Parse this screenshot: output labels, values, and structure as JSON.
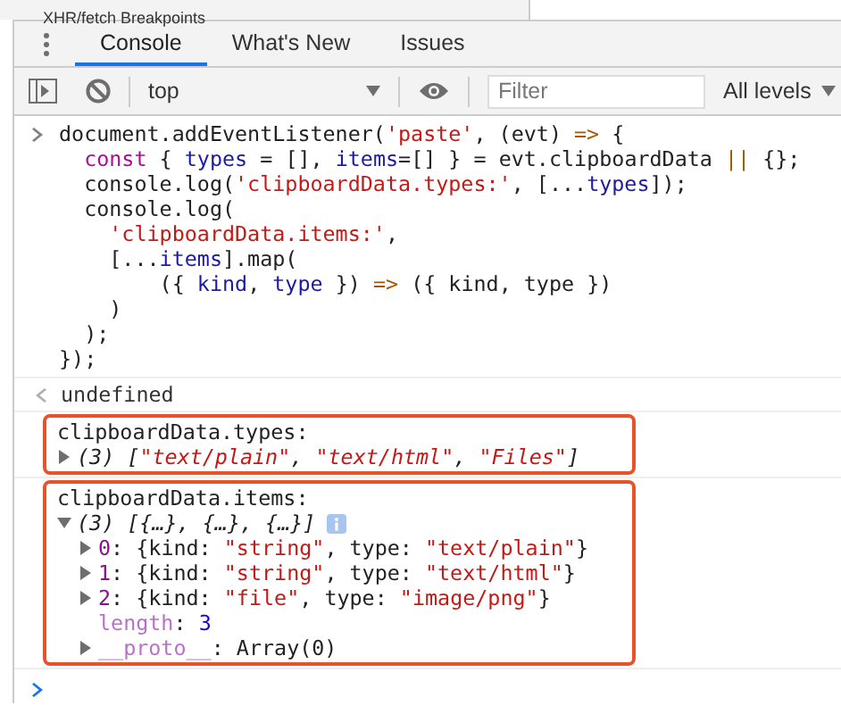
{
  "background_panel": {
    "text": "XHR/fetch Breakpoints"
  },
  "tabs": [
    {
      "label": "Console",
      "selected": true
    },
    {
      "label": "What's New",
      "selected": false
    },
    {
      "label": "Issues",
      "selected": false
    }
  ],
  "toolbar": {
    "context": "top",
    "filter": {
      "placeholder": "Filter"
    },
    "levels": "All levels"
  },
  "messages": [
    {
      "kind": "input",
      "lines": [
        [
          {
            "text": "document.addEventListener(",
            "kind": "plain"
          },
          {
            "text": "'paste'",
            "kind": "string"
          },
          {
            "text": ", (evt) ",
            "kind": "plain"
          },
          {
            "text": "=>",
            "kind": "operator"
          },
          {
            "text": " {",
            "kind": "plain"
          }
        ],
        [
          {
            "text": "  const",
            "kind": "keyword"
          },
          {
            "text": " { ",
            "kind": "plain"
          },
          {
            "text": "types",
            "kind": "name"
          },
          {
            "text": " = [], ",
            "kind": "plain"
          },
          {
            "text": "items",
            "kind": "name"
          },
          {
            "text": "=[] } = evt.clipboardData ",
            "kind": "plain"
          },
          {
            "text": "||",
            "kind": "operator"
          },
          {
            "text": " {};",
            "kind": "plain"
          }
        ],
        [
          {
            "text": "  console.log(",
            "kind": "plain"
          },
          {
            "text": "'clipboardData.types:'",
            "kind": "string"
          },
          {
            "text": ", [...",
            "kind": "plain"
          },
          {
            "text": "types",
            "kind": "name"
          },
          {
            "text": "]);",
            "kind": "plain"
          }
        ],
        [
          {
            "text": "  console.log(",
            "kind": "plain"
          }
        ],
        [
          {
            "text": "    'clipboardData.items:'",
            "kind": "string"
          },
          {
            "text": ",",
            "kind": "plain"
          }
        ],
        [
          {
            "text": "    [...",
            "kind": "plain"
          },
          {
            "text": "items",
            "kind": "name"
          },
          {
            "text": "].map(",
            "kind": "plain"
          }
        ],
        [
          {
            "text": "        ({ ",
            "kind": "plain"
          },
          {
            "text": "kind",
            "kind": "name"
          },
          {
            "text": ", ",
            "kind": "plain"
          },
          {
            "text": "type",
            "kind": "name"
          },
          {
            "text": " }) ",
            "kind": "plain"
          },
          {
            "text": "=>",
            "kind": "operator"
          },
          {
            "text": " ({ kind, type })",
            "kind": "plain"
          }
        ],
        [
          {
            "text": "    )",
            "kind": "plain"
          }
        ],
        [
          {
            "text": "  );",
            "kind": "plain"
          }
        ],
        [
          {
            "text": "});",
            "kind": "plain"
          }
        ]
      ]
    },
    {
      "kind": "result",
      "text": "undefined"
    },
    {
      "kind": "log",
      "highlighted": true,
      "label": "clipboardData.types:",
      "tree": {
        "kind": "object",
        "expanded": false,
        "tokens": [
          {
            "text": "(3) [",
            "kind": "plain"
          },
          {
            "text": "\"text/plain\"",
            "kind": "string"
          },
          {
            "text": ", ",
            "kind": "plain"
          },
          {
            "text": "\"text/html\"",
            "kind": "string"
          },
          {
            "text": ", ",
            "kind": "plain"
          },
          {
            "text": "\"Files\"",
            "kind": "string"
          },
          {
            "text": "]",
            "kind": "plain"
          }
        ]
      }
    },
    {
      "kind": "log",
      "highlighted": true,
      "label": "clipboardData.items:",
      "tree": {
        "kind": "object",
        "expanded": true,
        "info": true,
        "tokens": [
          {
            "text": "(3) [{…}, {…}, {…}]",
            "kind": "plain"
          }
        ],
        "children": [
          {
            "kind": "object",
            "expanded": false,
            "tokens": [
              {
                "text": "0",
                "kind": "index"
              },
              {
                "text": ": {kind: ",
                "kind": "plain"
              },
              {
                "text": "\"string\"",
                "kind": "string"
              },
              {
                "text": ", type: ",
                "kind": "plain"
              },
              {
                "text": "\"text/plain\"",
                "kind": "string"
              },
              {
                "text": "}",
                "kind": "plain"
              }
            ]
          },
          {
            "kind": "object",
            "expanded": false,
            "tokens": [
              {
                "text": "1",
                "kind": "index"
              },
              {
                "text": ": {kind: ",
                "kind": "plain"
              },
              {
                "text": "\"string\"",
                "kind": "string"
              },
              {
                "text": ", type: ",
                "kind": "plain"
              },
              {
                "text": "\"text/html\"",
                "kind": "string"
              },
              {
                "text": "}",
                "kind": "plain"
              }
            ]
          },
          {
            "kind": "object",
            "expanded": false,
            "tokens": [
              {
                "text": "2",
                "kind": "index"
              },
              {
                "text": ": {kind: ",
                "kind": "plain"
              },
              {
                "text": "\"file\"",
                "kind": "string"
              },
              {
                "text": ", type: ",
                "kind": "plain"
              },
              {
                "text": "\"image/png\"",
                "kind": "string"
              },
              {
                "text": "}",
                "kind": "plain"
              }
            ]
          },
          {
            "kind": "property",
            "tokens": [
              {
                "text": "length",
                "kind": "dimkey"
              },
              {
                "text": ": ",
                "kind": "plain"
              },
              {
                "text": "3",
                "kind": "number"
              }
            ]
          },
          {
            "kind": "object",
            "expanded": false,
            "tokens": [
              {
                "text": "__proto__",
                "kind": "dimkey"
              },
              {
                "text": ": Array(0)",
                "kind": "plain"
              }
            ]
          }
        ]
      }
    },
    {
      "kind": "prompt"
    }
  ]
}
